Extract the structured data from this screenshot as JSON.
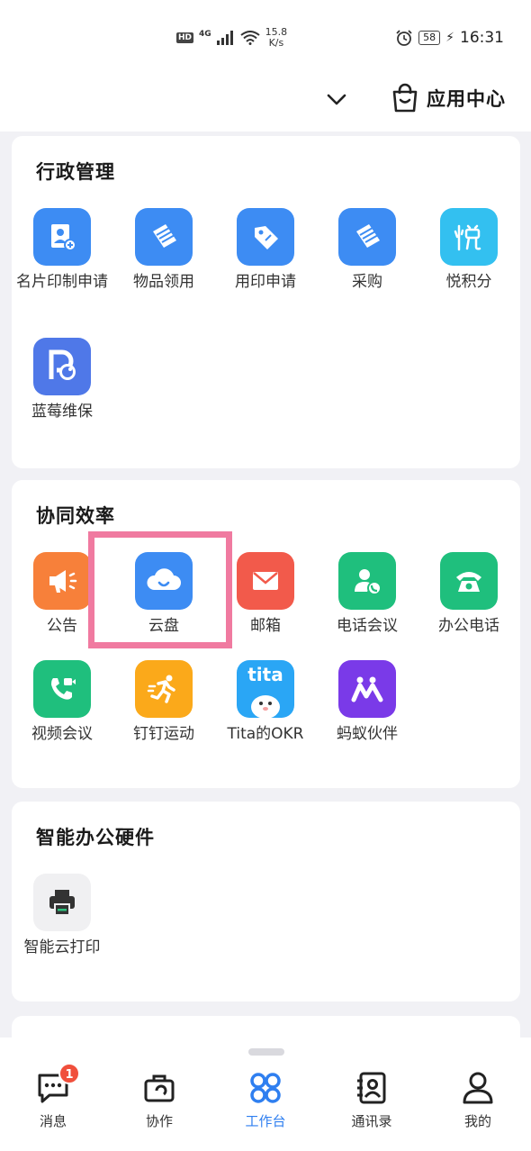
{
  "status_bar": {
    "hd": "HD",
    "signal": "4G",
    "speed_value": "15.8",
    "speed_unit": "K/s",
    "battery": "58",
    "time": "16:31"
  },
  "header": {
    "app_center_label": "应用中心"
  },
  "sections": {
    "admin": {
      "title": "行政管理",
      "items": [
        {
          "label": "名片印制申请",
          "icon": "business-card-icon",
          "color": "#3d8cf3"
        },
        {
          "label": "物品领用",
          "icon": "item-pickup-icon",
          "color": "#3d8cf3"
        },
        {
          "label": "用印申请",
          "icon": "stamp-tag-icon",
          "color": "#3d8cf3"
        },
        {
          "label": "采购",
          "icon": "purchase-icon",
          "color": "#3d8cf3"
        },
        {
          "label": "悦积分",
          "icon": "points-icon",
          "color": "#33c0f0"
        },
        {
          "label": "蓝莓维保",
          "icon": "blueberry-icon",
          "color": "#4f78e8"
        }
      ]
    },
    "collab": {
      "title": "协同效率",
      "items": [
        {
          "label": "公告",
          "icon": "megaphone-icon",
          "color": "#f7803a"
        },
        {
          "label": "云盘",
          "icon": "cloud-icon",
          "color": "#3d8cf3"
        },
        {
          "label": "邮箱",
          "icon": "mail-icon",
          "color": "#f25a4b"
        },
        {
          "label": "电话会议",
          "icon": "phone-meeting-icon",
          "color": "#1fbf7d"
        },
        {
          "label": "办公电话",
          "icon": "office-phone-icon",
          "color": "#1fbf7d"
        },
        {
          "label": "视频会议",
          "icon": "video-meeting-icon",
          "color": "#1fbf7d"
        },
        {
          "label": "钉钉运动",
          "icon": "running-icon",
          "color": "#fba91a"
        },
        {
          "label": "Tita的OKR",
          "icon": "tita-logo-icon",
          "color": "#2aa6f5",
          "logo_text": "tita"
        },
        {
          "label": "蚂蚁伙伴",
          "icon": "ant-partner-icon",
          "color": "#7a3ae8"
        }
      ]
    },
    "hardware": {
      "title": "智能办公硬件",
      "items": [
        {
          "label": "智能云打印",
          "icon": "printer-icon",
          "color": "#f0f0f2"
        }
      ]
    }
  },
  "tabbar": {
    "tabs": [
      {
        "label": "消息",
        "icon": "message-icon",
        "badge": "1"
      },
      {
        "label": "协作",
        "icon": "collaboration-icon"
      },
      {
        "label": "工作台",
        "icon": "workbench-icon",
        "active": true
      },
      {
        "label": "通讯录",
        "icon": "contacts-icon"
      },
      {
        "label": "我的",
        "icon": "profile-icon"
      }
    ],
    "active_color": "#2f7ff0"
  }
}
